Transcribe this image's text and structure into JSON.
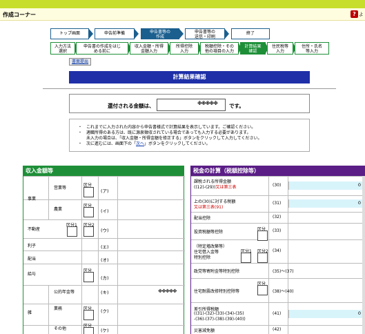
{
  "header": {
    "title": "作成コーナー",
    "help_label": "?",
    "help_label2": "よ"
  },
  "steps_main": [
    "トップ画面",
    "申告前準備",
    "申告書等の作成",
    "申告書等の送信・印刷",
    "終了"
  ],
  "steps_main_lines": [
    [
      "トップ画面"
    ],
    [
      "申告前準備"
    ],
    [
      "申告書等の",
      "作成"
    ],
    [
      "申告書等の",
      "送信・印刷"
    ],
    [
      "終了"
    ]
  ],
  "steps_sub": [
    [
      "入力方法",
      "選択"
    ],
    [
      "申告書の作成をはじ",
      "める前に"
    ],
    [
      "収入金額・所得",
      "金額入力"
    ],
    [
      "所得控除",
      "入力"
    ],
    [
      "税額控除・その",
      "他の項目の入力"
    ],
    [
      "計算結果",
      "確認"
    ],
    [
      "住民税等",
      "入力"
    ],
    [
      "住所・氏名",
      "等入力"
    ]
  ],
  "prev_button": "書面提出",
  "page_title": "計算結果確認",
  "refund": {
    "label": "還付される金額は、",
    "amount": "※※※※※",
    "suffix": "です。"
  },
  "notes": [
    "これまでに入力された内容から申告書様式で計算結果を表示しています。ご確認ください。",
    "適職所得のある方は、既に源泉徴収されている場合であっても入力する必要があります。",
    "未入力の場合は、「収入金額・所得金額を修正する」ボタンをクリックして入力してください。",
    "次に進むには、画面下の「次へ」ボタンをクリックしてください。"
  ],
  "notes_last": {
    "before": "次に進むには、画面下の「",
    "link": "次へ",
    "after": "」ボタンをクリックしてください。"
  },
  "income": {
    "title": "収入金額等",
    "kubun": "区分",
    "kubun1": "区分1",
    "kubun2": "区分2",
    "jigyo": "事業",
    "eigyo": "営業等",
    "nogyo": "農業",
    "fudosan": "不動産",
    "rishi": "利子",
    "haito": "配当",
    "kyuyo": "給与",
    "zatsu": "雑",
    "koteki": "公的年金等",
    "gyomu": "業務",
    "sonota": "その他",
    "codes": [
      "(ア)",
      "(イ)",
      "(ウ)",
      "(エ)",
      "(オ)",
      "(カ)",
      "(キ)",
      "(ク)",
      "(ケ)"
    ],
    "koteki_value": "※※※※※"
  },
  "tax": {
    "title": "税金の計算（税額控除等）",
    "rows": [
      {
        "l1": "課税される所得金額",
        "l2": "((12)-(29))",
        "l2red": "又は第三表",
        "code": "(30)",
        "val": "0"
      },
      {
        "l1": "上の(30)に対する税額",
        "l2": "",
        "l2red": "又は第三表(91)",
        "code": "(31)",
        "val": "0"
      },
      {
        "l1": "配当控除",
        "code": "(32)"
      },
      {
        "l1": "投資税額等控除",
        "code": "(33)"
      },
      {
        "l1": "（特定増改築等）",
        "l2": "住宅借入金等",
        "l3": "特別控除",
        "code": "(34)"
      },
      {
        "l1": "政党等寄附金等特別控除",
        "code": "(35)～(37)"
      },
      {
        "l1": "住宅耐震改修特別控除等",
        "code": "(38)～(40)"
      },
      {
        "l1": "差引所得税額",
        "l2": "((31)-(32)-(33)-(34)-(35)",
        "l3": "-(36)-(37)-(38)-(39)-(40))",
        "code": "(41)",
        "val": "0"
      },
      {
        "l1": "災害減免額",
        "code": "(42)"
      }
    ]
  },
  "colors": {
    "green": "#1e8f38",
    "blue": "#1b5f8f",
    "purple": "#5a1e86",
    "navy": "#1e2fa8",
    "lime": "#c7df2c"
  }
}
